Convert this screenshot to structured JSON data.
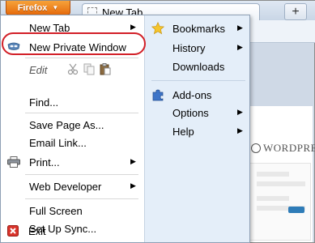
{
  "browser": {
    "app_button": "Firefox",
    "tab_title": "New Tab",
    "new_tab_symbol": "+"
  },
  "page_preview": {
    "logo_text": "WORDPRESS"
  },
  "menu_left": [
    {
      "label": "New Tab",
      "has_submenu": true
    },
    {
      "label": "New Private Window",
      "has_submenu": false
    },
    {
      "label": "Edit",
      "has_submenu": false
    },
    {
      "label": "Find...",
      "has_submenu": false
    },
    {
      "label": "Save Page As...",
      "has_submenu": false
    },
    {
      "label": "Email Link...",
      "has_submenu": false
    },
    {
      "label": "Print...",
      "has_submenu": true
    },
    {
      "label": "Web Developer",
      "has_submenu": true
    },
    {
      "label": "Full Screen",
      "has_submenu": false
    },
    {
      "label": "Set Up Sync...",
      "has_submenu": false
    },
    {
      "label": "Exit",
      "has_submenu": false
    }
  ],
  "menu_right": [
    {
      "label": "Bookmarks",
      "has_submenu": true
    },
    {
      "label": "History",
      "has_submenu": true
    },
    {
      "label": "Downloads",
      "has_submenu": false
    },
    {
      "label": "Add-ons",
      "has_submenu": false
    },
    {
      "label": "Options",
      "has_submenu": true
    },
    {
      "label": "Help",
      "has_submenu": true
    }
  ],
  "colors": {
    "highlight_ring": "#d21f27",
    "firefox_orange": "#e66b0c",
    "menu_right_bg": "#e4eef9"
  }
}
